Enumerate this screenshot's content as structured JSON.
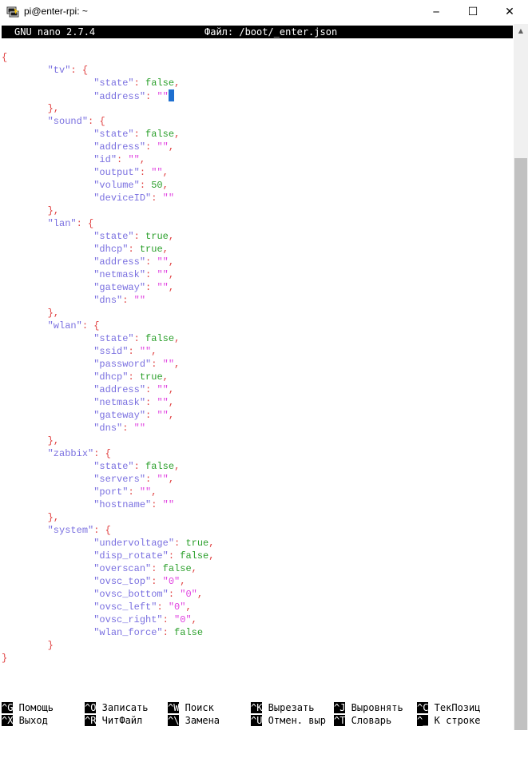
{
  "window": {
    "title": "pi@enter-rpi: ~",
    "minimize_glyph": "─",
    "maximize_glyph": "☐",
    "close_glyph": "✕",
    "icon": "putty-terminal-icon"
  },
  "nano": {
    "app": "GNU nano 2.7.4",
    "file_label": "Файл: /boot/_enter.json"
  },
  "editor": {
    "lines": [
      "{",
      "        \"tv\": {",
      "                \"state\": false,",
      "                \"address\": \"\"",
      "        },",
      "        \"sound\": {",
      "                \"state\": false,",
      "                \"address\": \"\",",
      "                \"id\": \"\",",
      "                \"output\": \"\",",
      "                \"volume\": 50,",
      "                \"deviceID\": \"\"",
      "        },",
      "        \"lan\": {",
      "                \"state\": true,",
      "                \"dhcp\": true,",
      "                \"address\": \"\",",
      "                \"netmask\": \"\",",
      "                \"gateway\": \"\",",
      "                \"dns\": \"\"",
      "        },",
      "        \"wlan\": {",
      "                \"state\": false,",
      "                \"ssid\": \"\",",
      "                \"password\": \"\",",
      "                \"dhcp\": true,",
      "                \"address\": \"\",",
      "                \"netmask\": \"\",",
      "                \"gateway\": \"\",",
      "                \"dns\": \"\"",
      "        },",
      "        \"zabbix\": {",
      "                \"state\": false,",
      "                \"servers\": \"\",",
      "                \"port\": \"\",",
      "                \"hostname\": \"\"",
      "        },",
      "        \"system\": {",
      "                \"undervoltage\": true,",
      "                \"disp_rotate\": false,",
      "                \"overscan\": false,",
      "                \"ovsc_top\": \"0\",",
      "                \"ovsc_bottom\": \"0\",",
      "                \"ovsc_left\": \"0\",",
      "                \"ovsc_right\": \"0\",",
      "                \"wlan_force\": false",
      "        }",
      "}"
    ],
    "cursor_line": 3
  },
  "shortcuts": {
    "row1": [
      {
        "key": "^G",
        "label": "Помощь"
      },
      {
        "key": "^O",
        "label": "Записать"
      },
      {
        "key": "^W",
        "label": "Поиск"
      },
      {
        "key": "^K",
        "label": "Вырезать"
      },
      {
        "key": "^J",
        "label": "Выровнять"
      },
      {
        "key": "^C",
        "label": "ТекПозиц"
      }
    ],
    "row2": [
      {
        "key": "^X",
        "label": "Выход"
      },
      {
        "key": "^R",
        "label": "ЧитФайл"
      },
      {
        "key": "^\\",
        "label": "Замена"
      },
      {
        "key": "^U",
        "label": "Отмен. выр"
      },
      {
        "key": "^T",
        "label": "Словарь"
      },
      {
        "key": "^_",
        "label": "К строке"
      }
    ]
  },
  "colors": {
    "punctuation": "#e04040",
    "key": "#7a70e0",
    "boolean_number": "#2ca02c",
    "string": "#e040e0",
    "cursor": "#1e6fd0"
  }
}
